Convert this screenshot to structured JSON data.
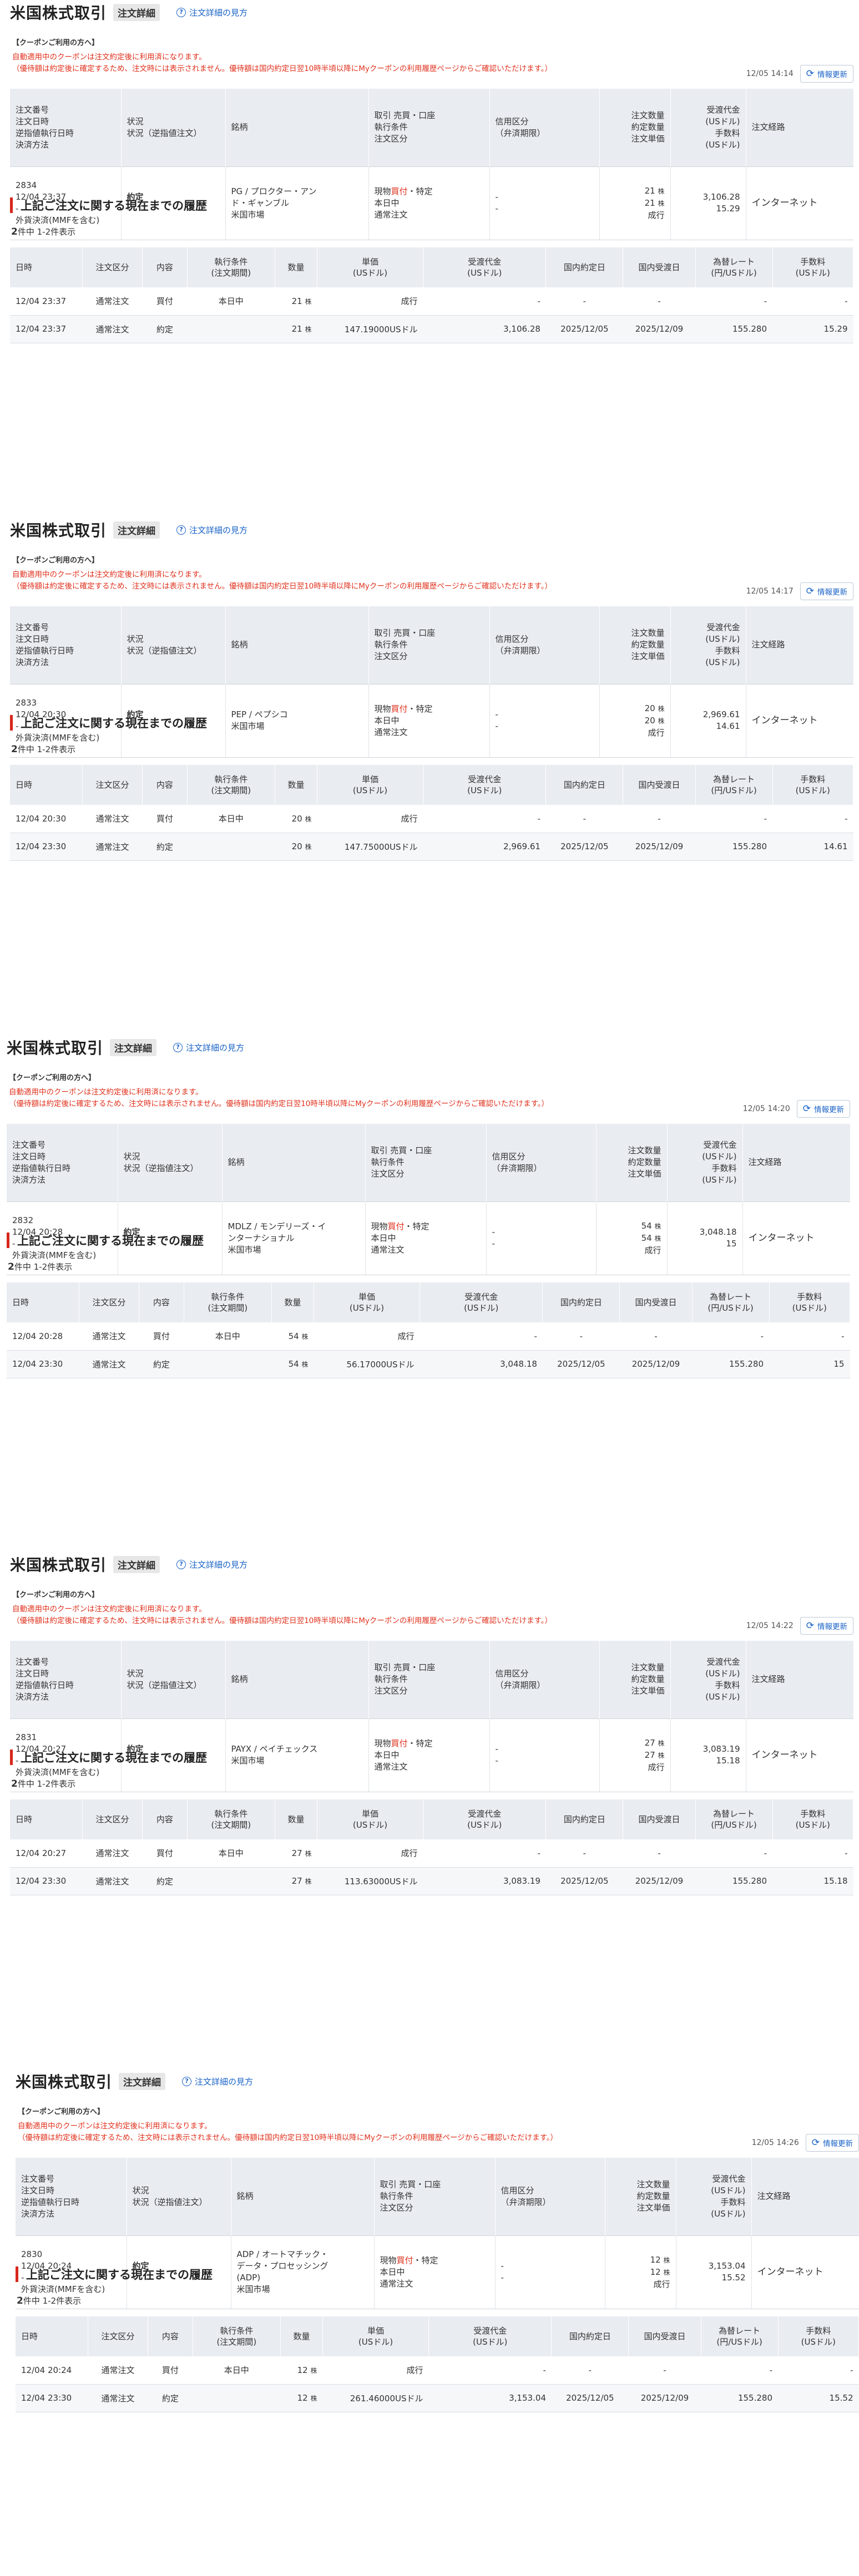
{
  "labels": {
    "page_title": "米国株式取引",
    "badge": "注文詳細",
    "help_link": "注文詳細の見方",
    "coupon_title": "【クーポンご利用の方へ】",
    "coupon_note_1": "自動適用中のクーポンは注文約定後に利用済になります。",
    "coupon_note_2": "（優待額は約定後に確定するため、注文時には表示されません。優待額は国内約定日翌10時半頃以降にMyクーポンの利用履歴ページからご確認いただけます。）",
    "update_button": "情報更新",
    "history_title": "上記ご注文に関する現在までの履歴",
    "count_pre": "件中 1-2件表示",
    "share_unit": "株",
    "main_headers": {
      "col1": [
        "注文番号",
        "注文日時",
        "逆指値執行日時",
        "決済方法"
      ],
      "col2": [
        "状況",
        "状況（逆指値注文）"
      ],
      "col3": [
        "銘柄"
      ],
      "col4": [
        "取引 売買・口座",
        "執行条件",
        "注文区分"
      ],
      "col5": [
        "信用区分",
        "（弁済期限）"
      ],
      "col6": [
        "注文数量",
        "約定数量",
        "注文単価"
      ],
      "col7": [
        "受渡代金",
        "(USドル)",
        "手数料",
        "(USドル)"
      ],
      "col8": [
        "注文経路"
      ]
    },
    "hist_headers": [
      "日時",
      "注文区分",
      "内容",
      "執行条件\n(注文期間)",
      "数量",
      "単価\n(USドル)",
      "受渡代金\n(USドル)",
      "国内約定日",
      "国内受渡日",
      "為替レート\n(円/USドル)",
      "手数料\n(USドル)"
    ]
  },
  "orders": [
    {
      "update_time": "12/05 14:14",
      "order_no": "2834",
      "order_datetime": "12/04 23:37",
      "stop_exec_datetime": "-",
      "settlement": "外貨決済(MMFを含む)",
      "status": "約定",
      "status_stop": "-",
      "stock_lines": [
        "PG / プロクター・アン",
        "ド・ギャンブル",
        "米国市場"
      ],
      "trade_prefix": "現物",
      "trade_side": "買付",
      "trade_suffix": "・特定",
      "exec_cond": "本日中",
      "order_type": "通常注文",
      "margin_1": "-",
      "margin_2": "-",
      "order_qty": "21",
      "filled_qty": "21",
      "unit_price": "成行",
      "settle_amount": "3,106.28",
      "fee": "15.29",
      "route": "インターネット",
      "history_count": "2",
      "history": [
        {
          "date": "12/04 23:37",
          "type": "通常注文",
          "content": "買付",
          "cond": "本日中",
          "qty": "21",
          "price": "成行",
          "amount": "-",
          "trade_date": "-",
          "settle_date": "-",
          "fx": "-",
          "fee": "-"
        },
        {
          "date": "12/04 23:37",
          "type": "通常注文",
          "content": "約定",
          "cond": "",
          "qty": "21",
          "price": "147.19000USドル",
          "amount": "3,106.28",
          "trade_date": "2025/12/05",
          "settle_date": "2025/12/09",
          "fx": "155.280",
          "fee": "15.29"
        }
      ]
    },
    {
      "update_time": "12/05 14:17",
      "order_no": "2833",
      "order_datetime": "12/04 20:30",
      "stop_exec_datetime": "-",
      "settlement": "外貨決済(MMFを含む)",
      "status": "約定",
      "status_stop": "-",
      "stock_lines": [
        "PEP / ペプシコ",
        "米国市場"
      ],
      "trade_prefix": "現物",
      "trade_side": "買付",
      "trade_suffix": "・特定",
      "exec_cond": "本日中",
      "order_type": "通常注文",
      "margin_1": "-",
      "margin_2": "-",
      "order_qty": "20",
      "filled_qty": "20",
      "unit_price": "成行",
      "settle_amount": "2,969.61",
      "fee": "14.61",
      "route": "インターネット",
      "history_count": "2",
      "history": [
        {
          "date": "12/04 20:30",
          "type": "通常注文",
          "content": "買付",
          "cond": "本日中",
          "qty": "20",
          "price": "成行",
          "amount": "-",
          "trade_date": "-",
          "settle_date": "-",
          "fx": "-",
          "fee": "-"
        },
        {
          "date": "12/04 23:30",
          "type": "通常注文",
          "content": "約定",
          "cond": "",
          "qty": "20",
          "price": "147.75000USドル",
          "amount": "2,969.61",
          "trade_date": "2025/12/05",
          "settle_date": "2025/12/09",
          "fx": "155.280",
          "fee": "14.61"
        }
      ]
    },
    {
      "update_time": "12/05 14:20",
      "order_no": "2832",
      "order_datetime": "12/04 20:28",
      "stop_exec_datetime": "-",
      "settlement": "外貨決済(MMFを含む)",
      "status": "約定",
      "status_stop": "-",
      "stock_lines": [
        "MDLZ / モンデリーズ・イ",
        "ンターナショナル",
        "米国市場"
      ],
      "trade_prefix": "現物",
      "trade_side": "買付",
      "trade_suffix": "・特定",
      "exec_cond": "本日中",
      "order_type": "通常注文",
      "margin_1": "-",
      "margin_2": "-",
      "order_qty": "54",
      "filled_qty": "54",
      "unit_price": "成行",
      "settle_amount": "3,048.18",
      "fee": "15",
      "route": "インターネット",
      "history_count": "2",
      "history": [
        {
          "date": "12/04 20:28",
          "type": "通常注文",
          "content": "買付",
          "cond": "本日中",
          "qty": "54",
          "price": "成行",
          "amount": "-",
          "trade_date": "-",
          "settle_date": "-",
          "fx": "-",
          "fee": "-"
        },
        {
          "date": "12/04 23:30",
          "type": "通常注文",
          "content": "約定",
          "cond": "",
          "qty": "54",
          "price": "56.17000USドル",
          "amount": "3,048.18",
          "trade_date": "2025/12/05",
          "settle_date": "2025/12/09",
          "fx": "155.280",
          "fee": "15"
        }
      ]
    },
    {
      "update_time": "12/05 14:22",
      "order_no": "2831",
      "order_datetime": "12/04 20:27",
      "stop_exec_datetime": "-",
      "settlement": "外貨決済(MMFを含む)",
      "status": "約定",
      "status_stop": "-",
      "stock_lines": [
        "PAYX / ペイチェックス",
        "米国市場"
      ],
      "trade_prefix": "現物",
      "trade_side": "買付",
      "trade_suffix": "・特定",
      "exec_cond": "本日中",
      "order_type": "通常注文",
      "margin_1": "-",
      "margin_2": "-",
      "order_qty": "27",
      "filled_qty": "27",
      "unit_price": "成行",
      "settle_amount": "3,083.19",
      "fee": "15.18",
      "route": "インターネット",
      "history_count": "2",
      "history": [
        {
          "date": "12/04 20:27",
          "type": "通常注文",
          "content": "買付",
          "cond": "本日中",
          "qty": "27",
          "price": "成行",
          "amount": "-",
          "trade_date": "-",
          "settle_date": "-",
          "fx": "-",
          "fee": "-"
        },
        {
          "date": "12/04 23:30",
          "type": "通常注文",
          "content": "約定",
          "cond": "",
          "qty": "27",
          "price": "113.63000USドル",
          "amount": "3,083.19",
          "trade_date": "2025/12/05",
          "settle_date": "2025/12/09",
          "fx": "155.280",
          "fee": "15.18"
        }
      ]
    },
    {
      "update_time": "12/05 14:26",
      "order_no": "2830",
      "order_datetime": "12/04 20:24",
      "stop_exec_datetime": "-",
      "settlement": "外貨決済(MMFを含む)",
      "status": "約定",
      "status_stop": "-",
      "stock_lines": [
        "ADP / オートマチック・",
        "データ・プロセッシング",
        "(ADP)",
        "米国市場"
      ],
      "trade_prefix": "現物",
      "trade_side": "買付",
      "trade_suffix": "・特定",
      "exec_cond": "本日中",
      "order_type": "通常注文",
      "margin_1": "-",
      "margin_2": "-",
      "order_qty": "12",
      "filled_qty": "12",
      "unit_price": "成行",
      "settle_amount": "3,153.04",
      "fee": "15.52",
      "route": "インターネット",
      "history_count": "2",
      "history": [
        {
          "date": "12/04 20:24",
          "type": "通常注文",
          "content": "買付",
          "cond": "本日中",
          "qty": "12",
          "price": "成行",
          "amount": "-",
          "trade_date": "-",
          "settle_date": "-",
          "fx": "-",
          "fee": "-"
        },
        {
          "date": "12/04 23:30",
          "type": "通常注文",
          "content": "約定",
          "cond": "",
          "qty": "12",
          "price": "261.46000USドル",
          "amount": "3,153.04",
          "trade_date": "2025/12/05",
          "settle_date": "2025/12/09",
          "fx": "155.280",
          "fee": "15.52"
        }
      ]
    }
  ]
}
